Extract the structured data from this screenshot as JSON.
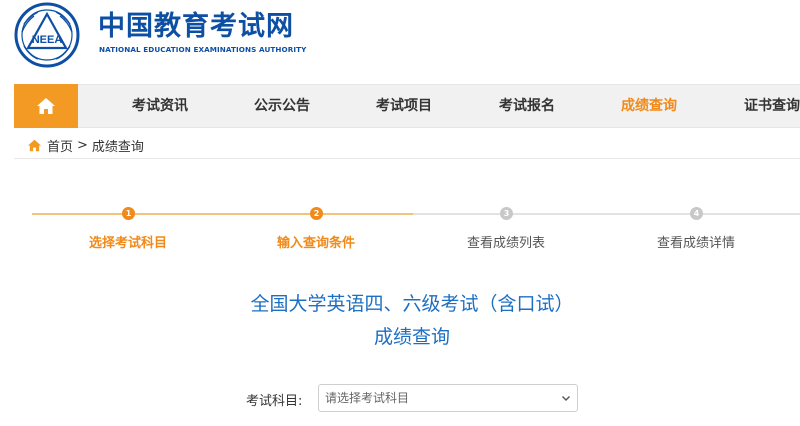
{
  "header": {
    "logo_text": "NEEA",
    "title": "中国教育考试网",
    "subtitle": "NATIONAL EDUCATION EXAMINATIONS AUTHORITY"
  },
  "nav": {
    "home_icon": "home-icon",
    "items": [
      {
        "label": "考试资讯",
        "active": false
      },
      {
        "label": "公示公告",
        "active": false
      },
      {
        "label": "考试项目",
        "active": false
      },
      {
        "label": "考试报名",
        "active": false
      },
      {
        "label": "成绩查询",
        "active": true
      },
      {
        "label": "证书查询",
        "active": false
      }
    ]
  },
  "breadcrumb": {
    "home": "首页",
    "separator": ">",
    "current": "成绩查询"
  },
  "steps": [
    {
      "number": "1",
      "label": "选择考试科目",
      "done": true
    },
    {
      "number": "2",
      "label": "输入查询条件",
      "done": true
    },
    {
      "number": "3",
      "label": "查看成绩列表",
      "done": false
    },
    {
      "number": "4",
      "label": "查看成绩详情",
      "done": false
    }
  ],
  "exam": {
    "title": "全国大学英语四、六级考试（含口试）",
    "subtitle": "成绩查询"
  },
  "form": {
    "subject_label": "考试科目:",
    "subject_placeholder": "请选择考试科目"
  },
  "colors": {
    "brand_blue": "#0d4fa3",
    "accent_orange": "#f08a1a",
    "title_blue": "#1d6fc2"
  }
}
